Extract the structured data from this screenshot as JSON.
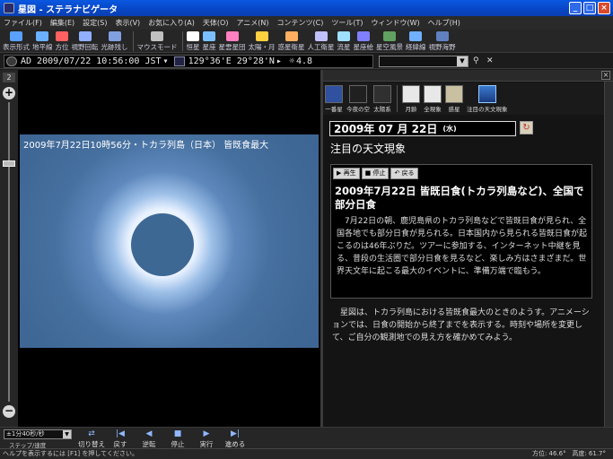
{
  "window": {
    "title": "星図 - ステラナビゲータ"
  },
  "menu": [
    "ファイル(F)",
    "編集(E)",
    "設定(S)",
    "表示(V)",
    "お気に入り(A)",
    "天体(O)",
    "アニメ(N)",
    "コンテンツ(C)",
    "ツール(T)",
    "ウィンドウ(W)",
    "ヘルプ(H)"
  ],
  "toolbar": {
    "items": [
      {
        "label": "表示形式",
        "icon": "display-icon",
        "color": "#5aa0ff"
      },
      {
        "label": "地平線",
        "icon": "horizon-icon",
        "color": "#6ab0ff"
      },
      {
        "label": "方位",
        "icon": "compass-icon",
        "color": "#ff6060"
      },
      {
        "label": "視野回転",
        "icon": "rotate-icon",
        "color": "#90b0ff"
      },
      {
        "label": "光跡残し",
        "icon": "trail-icon",
        "color": "#80a0e0"
      },
      {
        "label": "マウスモード",
        "icon": "mouse-icon",
        "color": "#c0c0c0"
      },
      {
        "label": "恒星",
        "icon": "star-icon",
        "color": "#ffffff"
      },
      {
        "label": "星座",
        "icon": "constellation-icon",
        "color": "#7ac0ff"
      },
      {
        "label": "星雲星団",
        "icon": "nebula-icon",
        "color": "#ff80c0"
      },
      {
        "label": "太陽・月",
        "icon": "sun-moon-icon",
        "color": "#ffd040"
      },
      {
        "label": "惑星衛星",
        "icon": "planet-icon",
        "color": "#ffb060"
      },
      {
        "label": "人工衛星",
        "icon": "satellite-icon",
        "color": "#c0c0ff"
      },
      {
        "label": "流星",
        "icon": "meteor-icon",
        "color": "#a0e0ff"
      },
      {
        "label": "星座絵",
        "icon": "constellation-art-icon",
        "color": "#8080ff"
      },
      {
        "label": "星空風景",
        "icon": "landscape-icon",
        "color": "#60a060"
      },
      {
        "label": "経緯線",
        "icon": "grid-icon",
        "color": "#70b0ff"
      },
      {
        "label": "視野海野",
        "icon": "field-icon",
        "color": "#6080c0"
      }
    ]
  },
  "infobar": {
    "datetime": "AD 2009/07/22 10:56:00 JST",
    "location": "129°36'E 29°28'N",
    "magnitude": "4.8"
  },
  "zoom": {
    "level": "2",
    "plus": "+",
    "minus": "−"
  },
  "sky": {
    "caption": "2009年7月22日10時56分・トカラ列島（日本） 皆既食最大"
  },
  "guide": {
    "tabs": [
      {
        "label": "一番星",
        "icon": "first-star-icon"
      },
      {
        "label": "今夜の空",
        "icon": "tonight-icon"
      },
      {
        "label": "太陽系",
        "icon": "solar-system-icon"
      },
      {
        "label": "月齢",
        "icon": "moon-age-icon"
      },
      {
        "label": "全現象",
        "icon": "all-events-icon"
      },
      {
        "label": "惑星",
        "icon": "planet-guide-icon"
      },
      {
        "label": "注目の天文現象",
        "icon": "featured-event-icon"
      }
    ],
    "date": "2009年 07 月 22日",
    "day_of_week": "(水)",
    "heading": "注目の天文現象",
    "controls": {
      "play": "▶ 再生",
      "stop": "■ 停止",
      "back": "↶ 戻る"
    },
    "event_title": "2009年7月22日 皆既日食(トカラ列島など)、全国で部分日食",
    "event_body": "　7月22日の朝、鹿児島県のトカラ列島などで皆既日食が見られ、全国各地でも部分日食が見られる。日本国内から見られる皆既日食が起こるのは46年ぶりだ。ツアーに参加する、インターネット中継を見る、昔段の生活圏で部分日食を見るなど、楽しみ方はさまざまだ。世界天文年に起こる最大のイベントに、準備万端で臨もう。",
    "description": "　星図は、トカラ列島における皆既食最大のときのようす。アニメーションでは、日食の開始から終了までを表示する。時刻や場所を変更して、ご自分の観測地での見え方を確かめてみよう。"
  },
  "playback": {
    "speed": "±1分40秒/秒",
    "speed_label": "ステップ/速度",
    "buttons": [
      {
        "label": "切り替え",
        "glyph": "⇄"
      },
      {
        "label": "戻す",
        "glyph": "|◀"
      },
      {
        "label": "逆転",
        "glyph": "◀"
      },
      {
        "label": "停止",
        "glyph": "■"
      },
      {
        "label": "実行",
        "glyph": "▶"
      },
      {
        "label": "進める",
        "glyph": "▶|"
      }
    ]
  },
  "status": {
    "help": "ヘルプを表示するには [F1] を押してください。",
    "azimuth": "方位: 46.6°",
    "altitude": "高度: 61.7°"
  }
}
